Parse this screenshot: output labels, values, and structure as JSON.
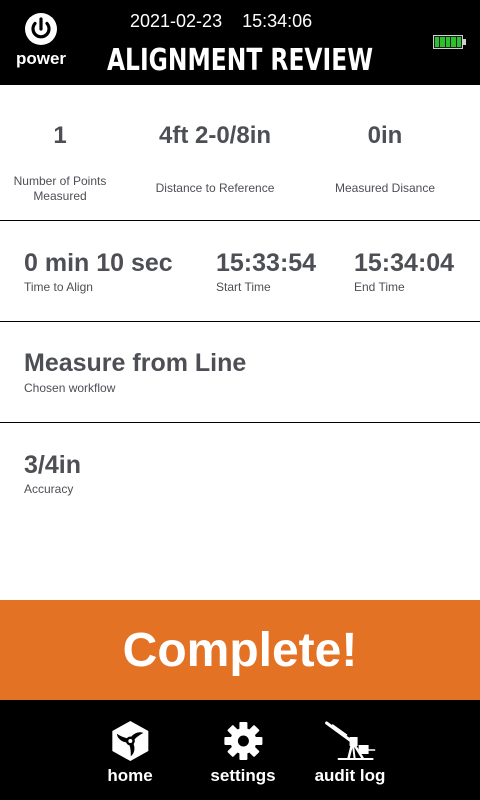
{
  "header": {
    "date": "2021-02-23",
    "time": "15:34:06",
    "title": "ALIGNMENT REVIEW",
    "power_label": "power",
    "battery_level_percent": 100,
    "battery_color": "#2cc12c"
  },
  "stats": {
    "points": {
      "value": "1",
      "label_line1": "Number of Points",
      "label_line2": "Measured"
    },
    "distance": {
      "value": "4ft 2-0/8in",
      "label": "Distance to Reference"
    },
    "measured": {
      "value": "0in",
      "label": "Measured Disance"
    }
  },
  "timing": {
    "time_to_align": {
      "value": "0 min 10 sec",
      "label": "Time to Align"
    },
    "start": {
      "value": "15:33:54",
      "label": "Start Time"
    },
    "end": {
      "value": "15:34:04",
      "label": "End Time"
    }
  },
  "workflow": {
    "value": "Measure from Line",
    "label": "Chosen workflow"
  },
  "accuracy": {
    "value": "3/4in",
    "label": "Accuracy"
  },
  "complete_button": {
    "label": "Complete!",
    "color": "#e37225"
  },
  "footer": {
    "home_label": "home",
    "settings_label": "settings",
    "audit_label": "audit log"
  },
  "icons": [
    "power-icon",
    "battery-icon",
    "home-icon",
    "gear-icon",
    "audit-log-icon"
  ]
}
